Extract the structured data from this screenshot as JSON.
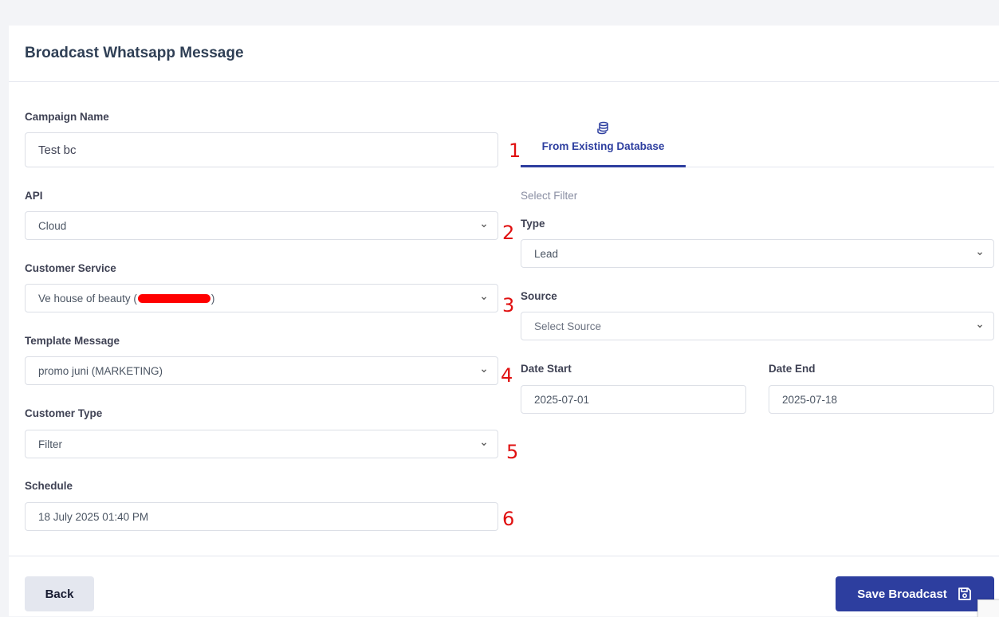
{
  "page": {
    "title": "Broadcast Whatsapp Message"
  },
  "form": {
    "campaign_name": {
      "label": "Campaign Name",
      "value": "Test bc"
    },
    "api": {
      "label": "API",
      "value": "Cloud"
    },
    "customer_service": {
      "label": "Customer Service",
      "value_prefix": "Ve house of beauty (",
      "value_suffix": ")"
    },
    "template_message": {
      "label": "Template Message",
      "value": "promo juni (MARKETING)"
    },
    "customer_type": {
      "label": "Customer Type",
      "value": "Filter"
    },
    "schedule": {
      "label": "Schedule",
      "value": "18 July 2025 01:40 PM"
    }
  },
  "markers": [
    "1",
    "2",
    "3",
    "4",
    "5",
    "6"
  ],
  "tabs": [
    {
      "label": "From Existing Database",
      "icon": "database-icon",
      "active": true
    }
  ],
  "filter": {
    "heading": "Select Filter",
    "type": {
      "label": "Type",
      "value": "Lead"
    },
    "source": {
      "label": "Source",
      "placeholder": "Select Source"
    },
    "date_start": {
      "label": "Date Start",
      "value": "2025-07-01"
    },
    "date_end": {
      "label": "Date End",
      "value": "2025-07-18"
    }
  },
  "footer": {
    "back_label": "Back",
    "save_label": "Save Broadcast",
    "save_icon": "save-icon"
  },
  "colors": {
    "primary": "#2d3e9f",
    "marker": "#e01010",
    "redaction": "#ff0000"
  }
}
